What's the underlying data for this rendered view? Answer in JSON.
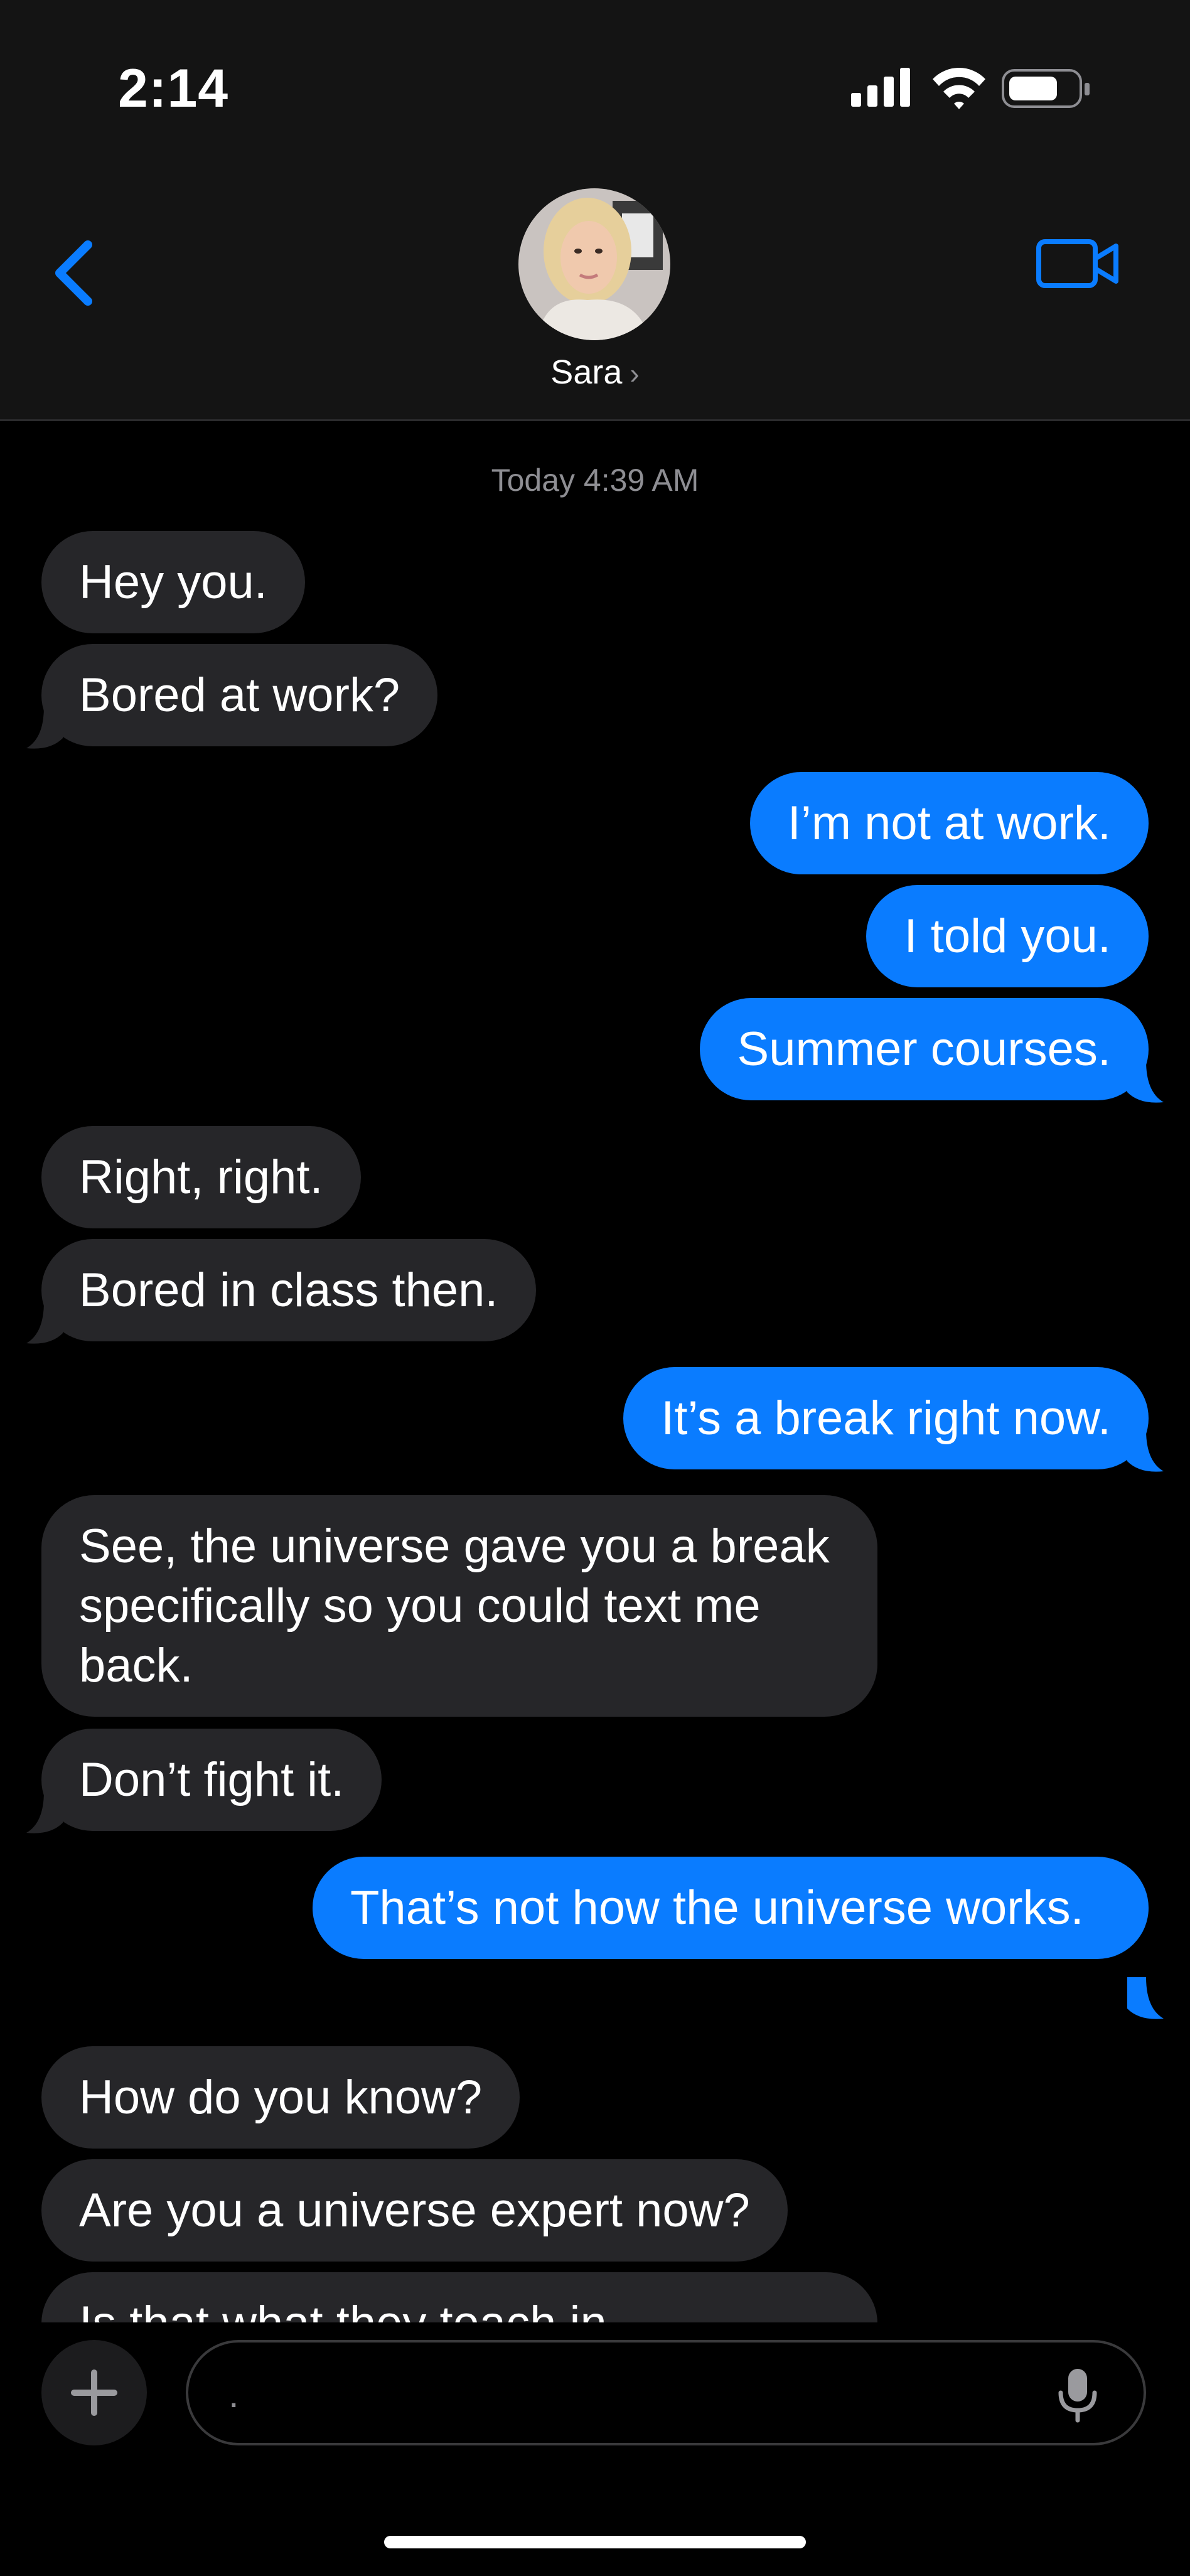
{
  "status": {
    "time": "2:14"
  },
  "header": {
    "contact_name": "Sara",
    "chevron": "›"
  },
  "thread": {
    "timestamp": "Today 4:39 AM",
    "messages": [
      {
        "side": "in",
        "text": "Hey you."
      },
      {
        "side": "in",
        "text": "Bored at work?"
      },
      {
        "side": "out",
        "text": "I’m not at work."
      },
      {
        "side": "out",
        "text": "I told you."
      },
      {
        "side": "out",
        "text": "Summer courses."
      },
      {
        "side": "in",
        "text": "Right, right."
      },
      {
        "side": "in",
        "text": "Bored in class then."
      },
      {
        "side": "out",
        "text": "It’s a break right now."
      },
      {
        "side": "in",
        "text": "See, the universe gave you a break specifically so you could text me back."
      },
      {
        "side": "in",
        "text": "Don’t fight it."
      },
      {
        "side": "out",
        "text": "That’s not how the universe works."
      },
      {
        "side": "in",
        "text": "How do you know?"
      },
      {
        "side": "in",
        "text": "Are you a universe expert now?"
      },
      {
        "side": "in",
        "text": "Is that what they teach in"
      }
    ]
  },
  "composer": {
    "placeholder": "."
  },
  "icons": {
    "back": "chevron-left-icon",
    "video": "video-camera-icon",
    "plus": "plus-icon",
    "mic": "microphone-icon",
    "signal": "cellular-signal-icon",
    "wifi": "wifi-icon",
    "battery": "battery-icon"
  },
  "colors": {
    "accent": "#0a7cff",
    "incoming_bubble": "#262629",
    "header_bg": "#141414",
    "background": "#000000",
    "secondary_text": "#8e8e93"
  }
}
